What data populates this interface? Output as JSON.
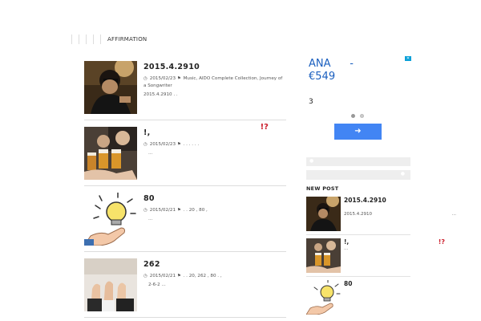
{
  "breadcrumb": {
    "current": "AFFIRMATION"
  },
  "posts": [
    {
      "title": "2015.4.2910",
      "date": "2015/02/23",
      "tags": "Music, AIDO Complete Collection, Journey of a Songwriter",
      "excerpt1": "2015.4.2910                                    . .",
      "excerpt2": "...",
      "mark": ""
    },
    {
      "title": "!,",
      "date": "2015/02/23",
      "tags": ". . . . . .",
      "excerpt1": "...",
      "excerpt2": "",
      "mark": "!?"
    },
    {
      "title": "80",
      "date": "2015/02/21",
      "tags": ". .  20 ,  80 ,",
      "excerpt1": "...",
      "excerpt2": "",
      "mark": ""
    },
    {
      "title": "262",
      "date": "2015/02/21",
      "tags": ". .  20, 262  ,  80 . ,",
      "excerpt1": "2-6-2 ...",
      "excerpt2": "",
      "mark": ""
    }
  ],
  "ad": {
    "title": "ANA\n€549",
    "dash": "-",
    "body": "3",
    "button": "➜",
    "close": "✕"
  },
  "search_icon": "search-icon",
  "new_post": {
    "heading": "NEW POST",
    "items": [
      {
        "title": "2015.4.2910",
        "text": "2015.4.2910",
        "dots": "...",
        "mark": ""
      },
      {
        "title": "!,",
        "text": "...",
        "dots": "",
        "mark": "!?"
      },
      {
        "title": "80",
        "text": "",
        "dots": "",
        "mark": ""
      }
    ]
  },
  "colors": {
    "accent": "#4285f4",
    "mark": "#cc1f2c",
    "ad_title": "#1a5fbf"
  }
}
